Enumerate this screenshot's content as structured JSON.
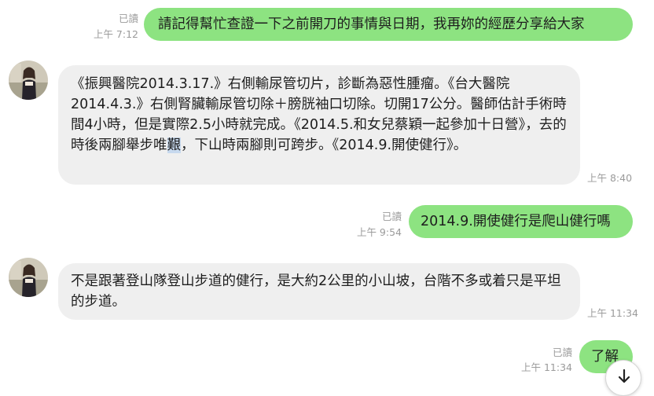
{
  "messages": [
    {
      "direction": "outgoing",
      "text": "請記得幫忙查證一下之前開刀的事情與日期，我再妳的經歷分享給大家",
      "read": "已讀",
      "time": "上午 7:12"
    },
    {
      "direction": "incoming",
      "text_before_highlight": "《振興醫院2014.3.17.》右側輸尿管切片，診斷為惡性腫瘤。《台大醫院2014.4.3.》右側腎臟輸尿管切除＋膀胱袖口切除。切開17公分。醫師估計手術時間4小時，但是實際2.5小時就完成。《2014.5.和女兒蔡穎一起參加十日營》，去的時後兩腳舉步唯",
      "highlight": "艱",
      "text_after_highlight": "，下山時兩腳則可跨步。《2014.9.開使健行》。",
      "time": "上午 8:40"
    },
    {
      "direction": "outgoing",
      "text": "2014.9.開使健行是爬山健行嗎",
      "read": "已讀",
      "time": "上午 9:54"
    },
    {
      "direction": "incoming",
      "text": "不是跟著登山隊登山步道的健行，是大約2公里的小山坡，台階不多或着只是平坦的步道。",
      "time": "上午 11:34"
    },
    {
      "direction": "outgoing",
      "text": "了解",
      "read": "已讀",
      "time": "上午 11:34"
    }
  ],
  "colors": {
    "outgoing_bubble": "#8de381",
    "incoming_bubble": "#efefef",
    "meta_text": "#9b9b9b",
    "highlight": "#c7d9ee"
  },
  "icons": {
    "avatar": "contact-avatar-photo",
    "scroll_button": "arrow-down-icon"
  }
}
